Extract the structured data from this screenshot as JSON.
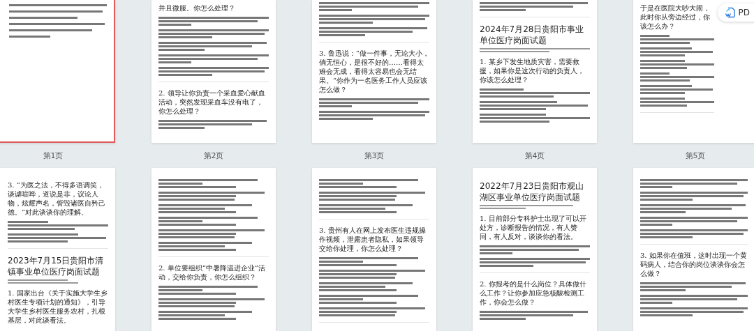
{
  "rows": [
    {
      "pages": [
        {
          "label": "第1页",
          "selected": true,
          "blocks": [
            {
              "kind": "toc"
            }
          ]
        },
        {
          "label": "第2页",
          "selected": false,
          "blocks": [
            {
              "kind": "question",
              "text": "并且微服。你怎么处理？"
            },
            {
              "kind": "paragraph"
            },
            {
              "kind": "paragraph"
            },
            {
              "kind": "paragraph"
            },
            {
              "kind": "paragraph"
            },
            {
              "kind": "paragraph"
            },
            {
              "kind": "rule"
            },
            {
              "kind": "question",
              "text": "2. 领导让你负责一个采血爱心献血活动，突然发现采血车没有电了，你怎么处理？"
            },
            {
              "kind": "paragraph"
            }
          ]
        },
        {
          "label": "第3页",
          "selected": false,
          "blocks": [
            {
              "kind": "paragraph"
            },
            {
              "kind": "paragraph"
            },
            {
              "kind": "paragraph"
            },
            {
              "kind": "rule"
            },
            {
              "kind": "question",
              "text": "3. 鲁迅说：“做一件事，无论大小，倘无恒心，是很不好的……看得太难会无成，看得太容易也会无结果。”你作为一名医务工作人员应该怎么做？"
            },
            {
              "kind": "paragraph"
            },
            {
              "kind": "paragraph"
            }
          ]
        },
        {
          "label": "第4页",
          "selected": false,
          "blocks": [
            {
              "kind": "paragraph"
            },
            {
              "kind": "rule"
            },
            {
              "kind": "title",
              "text": "2024年7月28日贵阳市事业单位医疗岗面试题"
            },
            {
              "kind": "note"
            },
            {
              "kind": "question",
              "text": "1. 某乡下发生地质灾害，需要救援，如果你是这次行动的负责人，你该怎么处理？"
            },
            {
              "kind": "paragraph"
            },
            {
              "kind": "paragraph"
            },
            {
              "kind": "paragraph"
            }
          ]
        },
        {
          "label": "第5页",
          "selected": false,
          "blocks": [
            {
              "kind": "question",
              "text": "于是在医院大吵大闹，此时你从旁边经过，你该怎么办？"
            },
            {
              "kind": "paragraph"
            },
            {
              "kind": "paragraph"
            },
            {
              "kind": "paragraph"
            },
            {
              "kind": "paragraph"
            },
            {
              "kind": "paragraph"
            },
            {
              "kind": "paragraph"
            },
            {
              "kind": "rule"
            }
          ]
        }
      ]
    },
    {
      "pages": [
        {
          "selected": false,
          "blocks": [
            {
              "kind": "question",
              "text": "3. “为医之法，不得多语调笑，谈谑喧哗，道说是非，议论人物，炫耀声名，訾毁诸医自矜己德。”对此谈谈你的理解。"
            },
            {
              "kind": "paragraph"
            },
            {
              "kind": "paragraph"
            },
            {
              "kind": "rule"
            },
            {
              "kind": "title",
              "text": "2023年7月15日贵阳市清镇事业单位医疗岗面试题"
            },
            {
              "kind": "note"
            },
            {
              "kind": "question",
              "text": "1. 国家出台《关于实施大学生乡村医生专项计划的通知》，引导大学生乡村医生服务农村，扎根基层，对此谈看法。"
            }
          ]
        },
        {
          "selected": false,
          "blocks": [
            {
              "kind": "paragraph"
            },
            {
              "kind": "paragraph"
            },
            {
              "kind": "paragraph"
            },
            {
              "kind": "paragraph"
            },
            {
              "kind": "paragraph"
            },
            {
              "kind": "paragraph"
            },
            {
              "kind": "rule"
            },
            {
              "kind": "question",
              "text": "2. 单位要组织“中暑降温进企业”活动，交给你负责，你怎么组织？"
            },
            {
              "kind": "paragraph"
            },
            {
              "kind": "paragraph"
            },
            {
              "kind": "paragraph"
            }
          ]
        },
        {
          "selected": false,
          "blocks": [
            {
              "kind": "paragraph"
            },
            {
              "kind": "paragraph"
            },
            {
              "kind": "paragraph"
            },
            {
              "kind": "rule"
            },
            {
              "kind": "question",
              "text": "3. 贵州有人在网上发布医生违规操作视频，泄露患者隐私，如果领导交给你处理，你怎么处理？"
            },
            {
              "kind": "paragraph"
            },
            {
              "kind": "paragraph"
            },
            {
              "kind": "paragraph"
            },
            {
              "kind": "paragraph"
            },
            {
              "kind": "paragraph"
            },
            {
              "kind": "rule"
            }
          ]
        },
        {
          "selected": false,
          "blocks": [
            {
              "kind": "title",
              "text": "2022年7月23日贵阳市观山湖区事业单位医疗岗面试题"
            },
            {
              "kind": "note"
            },
            {
              "kind": "question",
              "text": "1. 目前部分专科护士出现了可以开处方，诊断报告的情况，有人赞同，有人反对，谈谈你的看法。"
            },
            {
              "kind": "paragraph"
            },
            {
              "kind": "paragraph"
            },
            {
              "kind": "rule"
            },
            {
              "kind": "question",
              "text": "2. 你报考的是什么岗位？具体做什么工作？让你参加应急核酸检测工作，你会怎么做？"
            },
            {
              "kind": "paragraph"
            }
          ]
        },
        {
          "selected": false,
          "blocks": [
            {
              "kind": "paragraph"
            },
            {
              "kind": "paragraph"
            },
            {
              "kind": "paragraph"
            },
            {
              "kind": "paragraph"
            },
            {
              "kind": "paragraph"
            },
            {
              "kind": "rule"
            },
            {
              "kind": "question",
              "text": "3. 如果你在值班，这时出现一个黄码病人，结合你的岗位谈谈你会怎么做？"
            },
            {
              "kind": "paragraph"
            },
            {
              "kind": "paragraph"
            },
            {
              "kind": "paragraph"
            }
          ]
        }
      ]
    }
  ],
  "pdf_button": {
    "label": "PD"
  }
}
